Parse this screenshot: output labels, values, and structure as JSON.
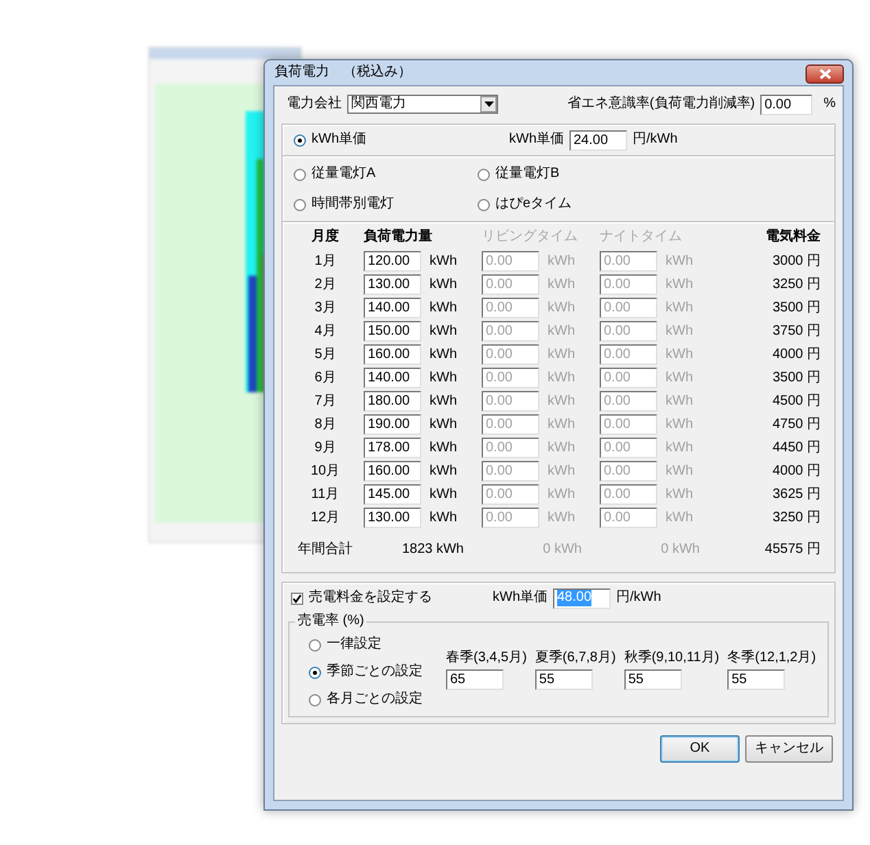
{
  "dialog": {
    "title": "負荷電力　（税込み）"
  },
  "company": {
    "label": "電力会社",
    "value": "関西電力"
  },
  "saving": {
    "label": "省エネ意識率(負荷電力削減率)",
    "value": "0.00",
    "unit": "%"
  },
  "plans": [
    {
      "label": "kWh単価",
      "selected": true
    },
    {
      "label": "従量電灯A",
      "selected": false
    },
    {
      "label": "従量電灯B",
      "selected": false
    },
    {
      "label": "時間帯別電灯",
      "selected": false
    },
    {
      "label": "はぴeタイム",
      "selected": false
    }
  ],
  "unit_price": {
    "label": "kWh単価",
    "value": "24.00",
    "unit": "円/kWh"
  },
  "table": {
    "columns": [
      {
        "label": "月度",
        "disabled": false
      },
      {
        "label": "負荷電力量",
        "disabled": false
      },
      {
        "label": "リビングタイム",
        "disabled": true
      },
      {
        "label": "ナイトタイム",
        "disabled": true
      },
      {
        "label": "電気料金",
        "disabled": false
      }
    ],
    "rows": [
      {
        "month": "1月",
        "inputs": [
          {
            "value": "120.00",
            "unit": "kWh",
            "disabled": false
          },
          {
            "value": "0.00",
            "unit": "kWh",
            "disabled": true
          },
          {
            "value": "0.00",
            "unit": "kWh",
            "disabled": true
          }
        ],
        "fee": "3000 円"
      },
      {
        "month": "2月",
        "inputs": [
          {
            "value": "130.00",
            "unit": "kWh",
            "disabled": false
          },
          {
            "value": "0.00",
            "unit": "kWh",
            "disabled": true
          },
          {
            "value": "0.00",
            "unit": "kWh",
            "disabled": true
          }
        ],
        "fee": "3250 円"
      },
      {
        "month": "3月",
        "inputs": [
          {
            "value": "140.00",
            "unit": "kWh",
            "disabled": false
          },
          {
            "value": "0.00",
            "unit": "kWh",
            "disabled": true
          },
          {
            "value": "0.00",
            "unit": "kWh",
            "disabled": true
          }
        ],
        "fee": "3500 円"
      },
      {
        "month": "4月",
        "inputs": [
          {
            "value": "150.00",
            "unit": "kWh",
            "disabled": false
          },
          {
            "value": "0.00",
            "unit": "kWh",
            "disabled": true
          },
          {
            "value": "0.00",
            "unit": "kWh",
            "disabled": true
          }
        ],
        "fee": "3750 円"
      },
      {
        "month": "5月",
        "inputs": [
          {
            "value": "160.00",
            "unit": "kWh",
            "disabled": false
          },
          {
            "value": "0.00",
            "unit": "kWh",
            "disabled": true
          },
          {
            "value": "0.00",
            "unit": "kWh",
            "disabled": true
          }
        ],
        "fee": "4000 円"
      },
      {
        "month": "6月",
        "inputs": [
          {
            "value": "140.00",
            "unit": "kWh",
            "disabled": false
          },
          {
            "value": "0.00",
            "unit": "kWh",
            "disabled": true
          },
          {
            "value": "0.00",
            "unit": "kWh",
            "disabled": true
          }
        ],
        "fee": "3500 円"
      },
      {
        "month": "7月",
        "inputs": [
          {
            "value": "180.00",
            "unit": "kWh",
            "disabled": false
          },
          {
            "value": "0.00",
            "unit": "kWh",
            "disabled": true
          },
          {
            "value": "0.00",
            "unit": "kWh",
            "disabled": true
          }
        ],
        "fee": "4500 円"
      },
      {
        "month": "8月",
        "inputs": [
          {
            "value": "190.00",
            "unit": "kWh",
            "disabled": false
          },
          {
            "value": "0.00",
            "unit": "kWh",
            "disabled": true
          },
          {
            "value": "0.00",
            "unit": "kWh",
            "disabled": true
          }
        ],
        "fee": "4750 円"
      },
      {
        "month": "9月",
        "inputs": [
          {
            "value": "178.00",
            "unit": "kWh",
            "disabled": false
          },
          {
            "value": "0.00",
            "unit": "kWh",
            "disabled": true
          },
          {
            "value": "0.00",
            "unit": "kWh",
            "disabled": true
          }
        ],
        "fee": "4450 円"
      },
      {
        "month": "10月",
        "inputs": [
          {
            "value": "160.00",
            "unit": "kWh",
            "disabled": false
          },
          {
            "value": "0.00",
            "unit": "kWh",
            "disabled": true
          },
          {
            "value": "0.00",
            "unit": "kWh",
            "disabled": true
          }
        ],
        "fee": "4000 円"
      },
      {
        "month": "11月",
        "inputs": [
          {
            "value": "145.00",
            "unit": "kWh",
            "disabled": false
          },
          {
            "value": "0.00",
            "unit": "kWh",
            "disabled": true
          },
          {
            "value": "0.00",
            "unit": "kWh",
            "disabled": true
          }
        ],
        "fee": "3625 円"
      },
      {
        "month": "12月",
        "inputs": [
          {
            "value": "130.00",
            "unit": "kWh",
            "disabled": false
          },
          {
            "value": "0.00",
            "unit": "kWh",
            "disabled": true
          },
          {
            "value": "0.00",
            "unit": "kWh",
            "disabled": true
          }
        ],
        "fee": "3250 円"
      }
    ],
    "total": {
      "label": "年間合計",
      "values": [
        {
          "value": "1823 kWh",
          "disabled": false
        },
        {
          "value": "0 kWh",
          "disabled": true
        },
        {
          "value": "0 kWh",
          "disabled": true
        }
      ],
      "fee": "45575 円"
    }
  },
  "sell": {
    "enable": {
      "label": "売電料金を設定する",
      "checked": true
    },
    "unit_price": {
      "label": "kWh単価",
      "value": "48.00",
      "unit": "円/kWh",
      "selected": true
    },
    "rate": {
      "title": "売電率 (%)",
      "modes": [
        {
          "label": "一律設定",
          "selected": false
        },
        {
          "label": "季節ごとの設定",
          "selected": true
        },
        {
          "label": "各月ごとの設定",
          "selected": false
        }
      ],
      "seasons": [
        {
          "label": "春季(3,4,5月)",
          "value": "65"
        },
        {
          "label": "夏季(6,7,8月)",
          "value": "55"
        },
        {
          "label": "秋季(9,10,11月)",
          "value": "55"
        },
        {
          "label": "冬季(12,1,2月)",
          "value": "55"
        }
      ]
    }
  },
  "buttons": [
    {
      "label": "OK",
      "default": true
    },
    {
      "label": "キャンセル",
      "default": false
    }
  ]
}
